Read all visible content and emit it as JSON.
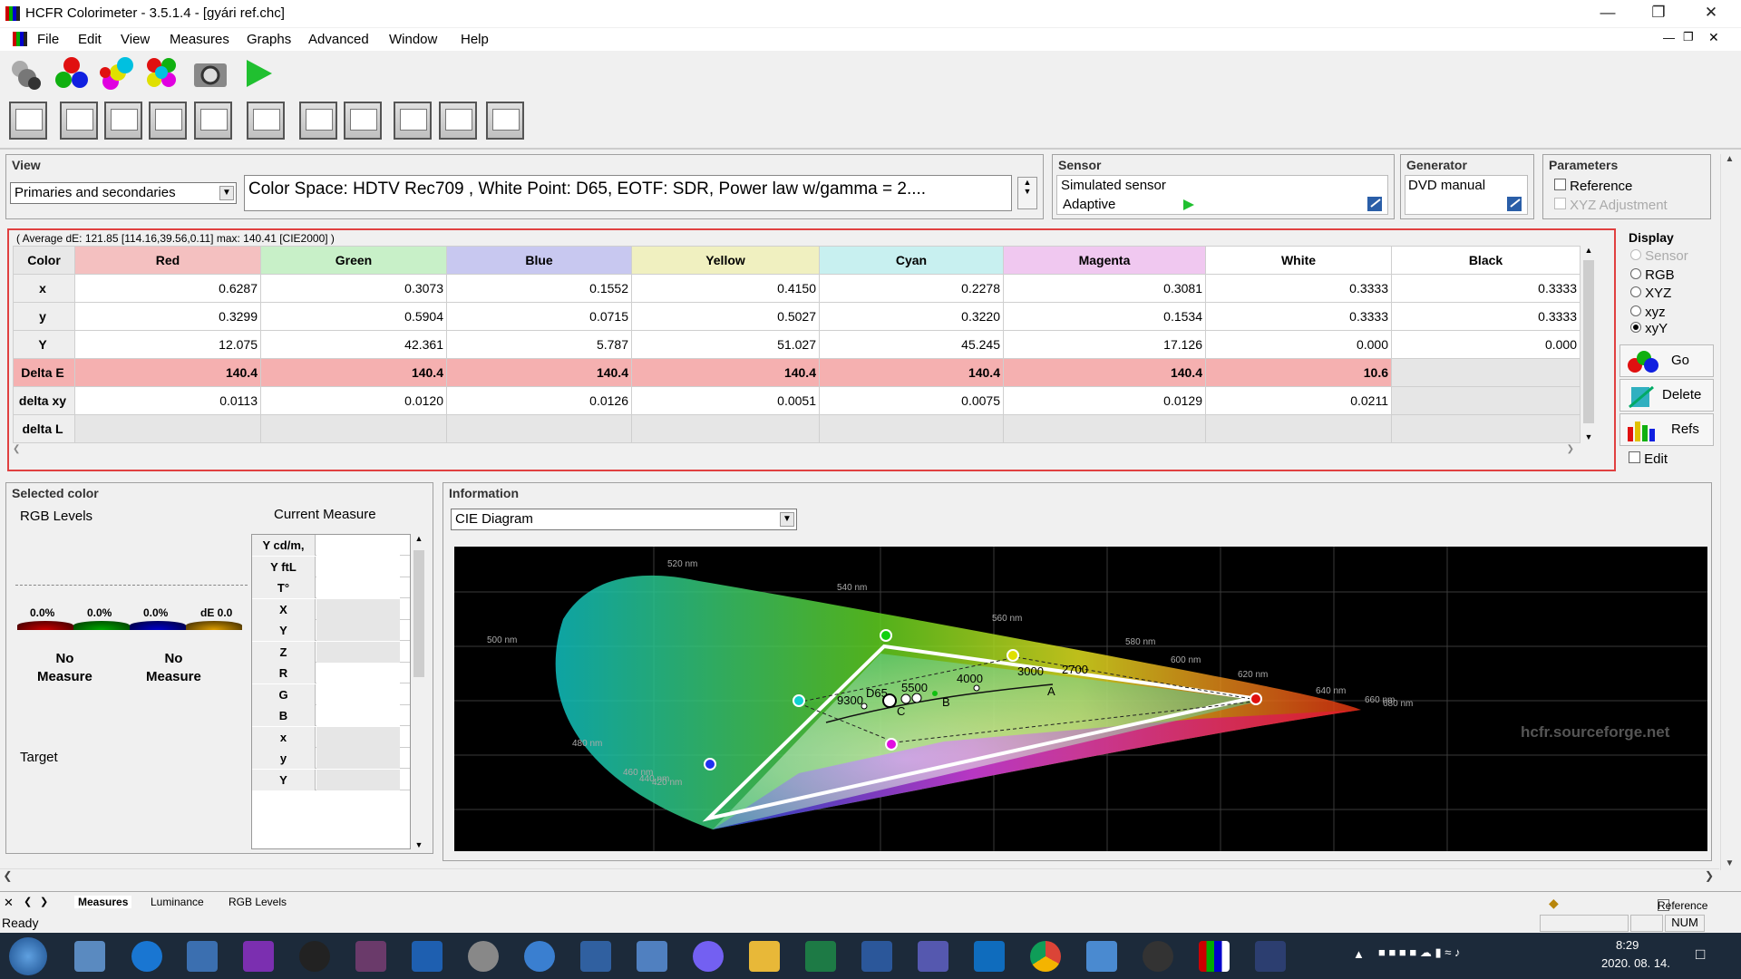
{
  "window": {
    "title": "HCFR Colorimeter - 3.5.1.4 - [gyári ref.chc]"
  },
  "menu": [
    "File",
    "Edit",
    "View",
    "Measures",
    "Graphs",
    "Advanced",
    "Window",
    "Help"
  ],
  "view_panel": {
    "title": "View",
    "combo_value": "Primaries and secondaries",
    "info": "Color Space: HDTV Rec709 , White Point: D65, EOTF:  SDR, Power law w/gamma = 2...."
  },
  "sensor_panel": {
    "title": "Sensor",
    "name": "Simulated sensor",
    "mode": "Adaptive"
  },
  "generator_panel": {
    "title": "Generator",
    "name": "DVD manual"
  },
  "parameters_panel": {
    "title": "Parameters",
    "reference": "Reference",
    "xyz_adjust": "XYZ Adjustment"
  },
  "summary": "( Average dE: 121.85 [114.16,39.56,0.11] max: 140.41 [CIE2000] )",
  "table": {
    "headers": [
      "Color",
      "Red",
      "Green",
      "Blue",
      "Yellow",
      "Cyan",
      "Magenta",
      "White",
      "Black"
    ],
    "header_colors": [
      "#e8e8e8",
      "#f4c0c0",
      "#c8f0c8",
      "#c8c8f0",
      "#f0f0c0",
      "#c8f0f0",
      "#f0c8f0",
      "#ffffff",
      "#ffffff"
    ],
    "rows": [
      {
        "label": "x",
        "values": [
          "0.6287",
          "0.3073",
          "0.1552",
          "0.4150",
          "0.2278",
          "0.3081",
          "0.3333",
          "0.3333"
        ]
      },
      {
        "label": "y",
        "values": [
          "0.3299",
          "0.5904",
          "0.0715",
          "0.5027",
          "0.3220",
          "0.1534",
          "0.3333",
          "0.3333"
        ]
      },
      {
        "label": "Y",
        "values": [
          "12.075",
          "42.361",
          "5.787",
          "51.027",
          "45.245",
          "17.126",
          "0.000",
          "0.000"
        ]
      },
      {
        "label": "Delta E",
        "values": [
          "140.4",
          "140.4",
          "140.4",
          "140.4",
          "140.4",
          "140.4",
          "10.6",
          ""
        ]
      },
      {
        "label": "delta xy",
        "values": [
          "0.0113",
          "0.0120",
          "0.0126",
          "0.0051",
          "0.0075",
          "0.0129",
          "0.0211",
          ""
        ]
      },
      {
        "label": "delta L",
        "values": [
          "",
          "",
          "",
          "",
          "",
          "",
          "",
          ""
        ]
      }
    ]
  },
  "display_panel": {
    "title": "Display",
    "options": [
      "Sensor",
      "RGB",
      "XYZ",
      "xyz",
      "xyY"
    ],
    "selected": "xyY",
    "go": "Go",
    "delete": "Delete",
    "refs": "Refs",
    "edit": "Edit"
  },
  "selected_color": {
    "title": "Selected color",
    "rgb_levels": "RGB Levels",
    "current_measure": "Current Measure",
    "levels": [
      "0.0%",
      "0.0%",
      "0.0%",
      "dE 0.0"
    ],
    "no_measure_1": "No",
    "no_measure_2": "Measure",
    "target": "Target",
    "rows": [
      "Y cd/m,",
      "Y ftL",
      "T°",
      "X",
      "Y",
      "Z",
      "R",
      "G",
      "B",
      "x",
      "y",
      "Y"
    ]
  },
  "information": {
    "title": "Information",
    "combo_value": "CIE Diagram",
    "wavelengths": [
      "520 nm",
      "540 nm",
      "560 nm",
      "580 nm",
      "500 nm",
      "600 nm",
      "620 nm",
      "640 nm",
      "660 nm",
      "680 nm",
      "480 nm",
      "460 nm",
      "440 nm",
      "420 nm"
    ],
    "temps": [
      "9300",
      "D65",
      "5500",
      "4000",
      "3000",
      "2700"
    ],
    "illuminants": [
      "A",
      "B",
      "C"
    ],
    "watermark": "hcfr.sourceforge.net"
  },
  "bottom_tabs": [
    "Measures",
    "Luminance",
    "RGB Levels"
  ],
  "status": {
    "text": "Ready",
    "reference": "Reference",
    "num": "NUM"
  },
  "taskbar": {
    "time": "8:29",
    "date": "2020. 08. 14."
  }
}
